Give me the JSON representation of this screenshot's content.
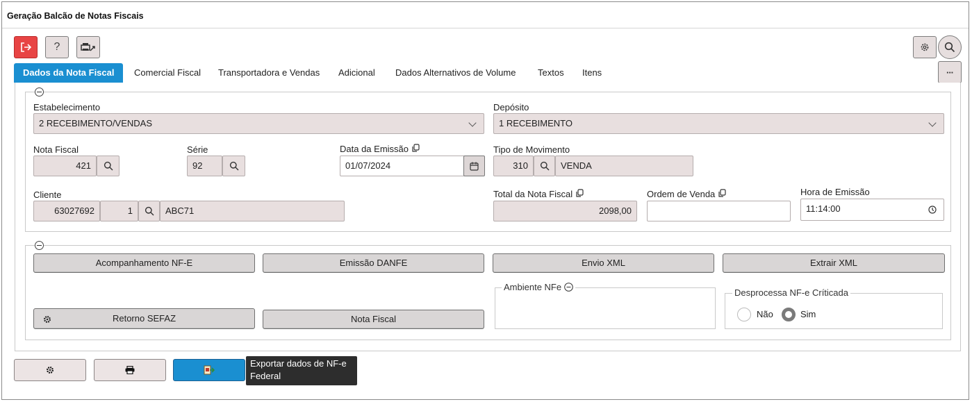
{
  "window": {
    "title": "Geração Balcão de Notas Fiscais"
  },
  "toolbar": {
    "exit_icon": "logout-icon",
    "help_label": "?",
    "print_icon": "printer-settings-icon",
    "settings_icon": "gear-icon",
    "search_icon": "search-icon"
  },
  "tabs": [
    {
      "label": "Dados da Nota Fiscal",
      "active": true
    },
    {
      "label": "Comercial Fiscal"
    },
    {
      "label": "Transportadora e Vendas"
    },
    {
      "label": "Adicional"
    },
    {
      "label": "Dados Alternativos de Volume"
    },
    {
      "label": "Textos"
    },
    {
      "label": "Itens"
    }
  ],
  "more_label": "···",
  "form": {
    "estabelecimento": {
      "label": "Estabelecimento",
      "value": "2 RECEBIMENTO/VENDAS"
    },
    "deposito": {
      "label": "Depósito",
      "value": "1 RECEBIMENTO"
    },
    "nota_fiscal": {
      "label": "Nota Fiscal",
      "value": "421"
    },
    "serie": {
      "label": "Série",
      "value": "92"
    },
    "data_emissao": {
      "label": "Data da Emissão",
      "value": "01/07/2024"
    },
    "tipo_movimento": {
      "label": "Tipo de Movimento",
      "code": "310",
      "description": "VENDA"
    },
    "cliente": {
      "label": "Cliente",
      "code": "63027692",
      "branch": "1",
      "name": "ABC71"
    },
    "total_nota": {
      "label": "Total da Nota Fiscal",
      "value": "2098,00"
    },
    "ordem_venda": {
      "label": "Ordem de Venda",
      "value": ""
    },
    "hora_emissao": {
      "label": "Hora de Emissão",
      "value": "11:14:00"
    }
  },
  "actions": {
    "acompanhamento": "Acompanhamento NF-E",
    "emissao_danfe": "Emissão DANFE",
    "envio_xml": "Envio XML",
    "extrair_xml": "Extrair XML",
    "retorno_sefaz": "Retorno SEFAZ",
    "nota_fiscal": "Nota Fiscal"
  },
  "ambiente": {
    "legend": "Ambiente NFe"
  },
  "desprocessa": {
    "legend": "Desprocessa NF-e Críticada",
    "options": [
      {
        "label": "Não",
        "selected": false
      },
      {
        "label": "Sim",
        "selected": true
      }
    ]
  },
  "footer": {
    "tooltip": "Exportar dados de NF-e Federal"
  },
  "colors": {
    "accent": "#1a8fd1",
    "exit_button": "#e84444",
    "field_bg": "#e8dfdf"
  }
}
